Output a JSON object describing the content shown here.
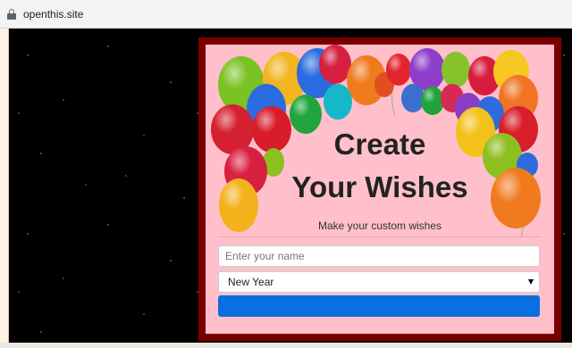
{
  "browser": {
    "url": "openthis.site",
    "lock_icon": "lock-icon"
  },
  "card": {
    "title_line1": "Create",
    "title_line2": "Your Wishes",
    "subtitle": "Make your custom wishes",
    "name_input": {
      "value": "",
      "placeholder": "Enter your name"
    },
    "occasion_select": {
      "selected": "New Year"
    },
    "submit_label": "",
    "colors": {
      "frame": "#7a0000",
      "background": "#ffc0cb",
      "button": "#0a6fe0"
    }
  },
  "decoration": "balloons"
}
